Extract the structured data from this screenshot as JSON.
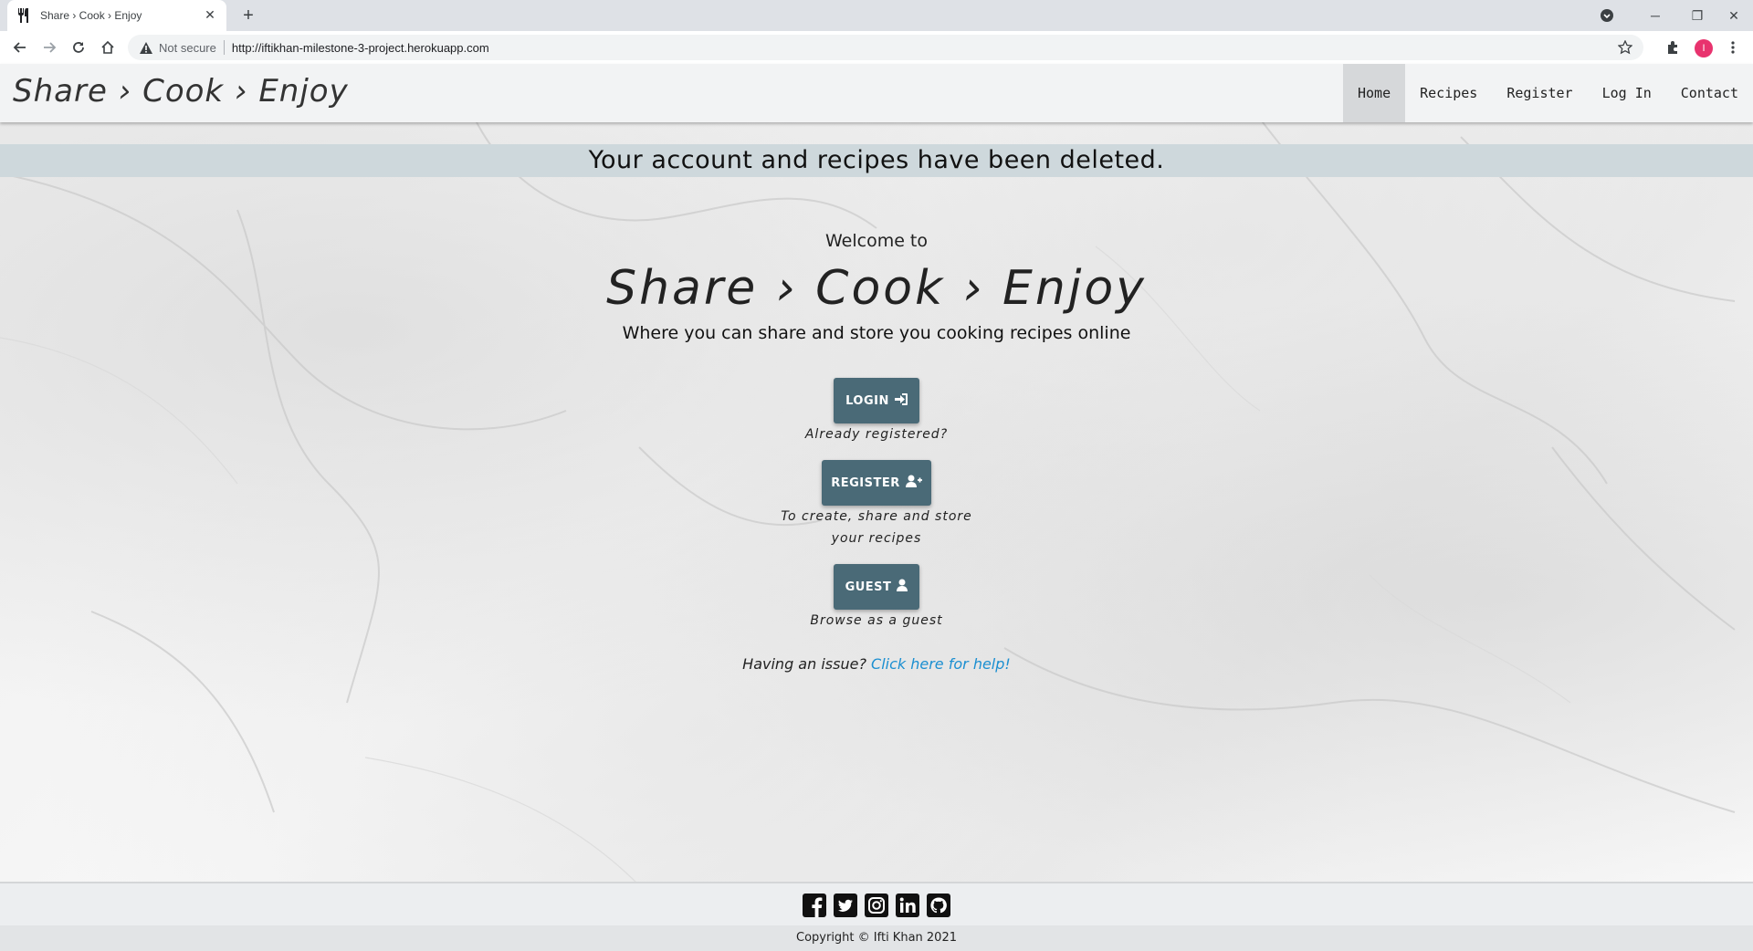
{
  "browser": {
    "tab_title": "Share › Cook › Enjoy",
    "security_label": "Not secure",
    "url": "http://iftikhan-milestone-3-project.herokuapp.com",
    "profile_initial": "I"
  },
  "navbar": {
    "brand": "Share › Cook › Enjoy",
    "items": [
      {
        "label": "Home",
        "active": true
      },
      {
        "label": "Recipes",
        "active": false
      },
      {
        "label": "Register",
        "active": false
      },
      {
        "label": "Log In",
        "active": false
      },
      {
        "label": "Contact",
        "active": false
      }
    ]
  },
  "flash_message": "Your account and recipes have been deleted.",
  "hero": {
    "welcome": "Welcome to",
    "brand": "Share › Cook › Enjoy",
    "tagline": "Where you can share and store you cooking recipes online"
  },
  "actions": {
    "login": {
      "label": "LOGIN",
      "icon": "sign-in-icon",
      "note": "Already registered?"
    },
    "register": {
      "label": "REGISTER",
      "icon": "user-plus-icon",
      "note_line1": "To create, share and store",
      "note_line2": "your recipes"
    },
    "guest": {
      "label": "GUEST",
      "icon": "user-icon",
      "note": "Browse as a guest"
    }
  },
  "help": {
    "prefix": "Having an issue?",
    "link": "Click here for help!"
  },
  "footer": {
    "socials": [
      "facebook-icon",
      "twitter-icon",
      "instagram-icon",
      "linkedin-icon",
      "github-icon"
    ],
    "copyright": "Copyright © Ifti Khan 2021"
  },
  "colors": {
    "button": "#4a6a77",
    "flash_bg": "#ced8dc",
    "link": "#1b8fd1",
    "nav_bg": "#f2f3f4"
  }
}
